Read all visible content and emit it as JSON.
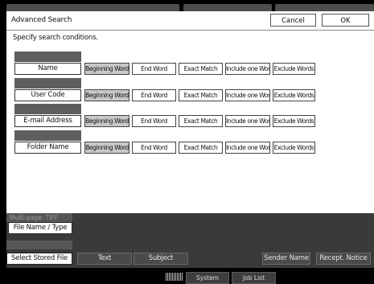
{
  "header": {
    "title": "Advanced Search",
    "cancel_label": "Cancel",
    "ok_label": "OK"
  },
  "instruction": "Specify search conditions.",
  "conditions": [
    {
      "label": "Name",
      "selected": "Beginning Word"
    },
    {
      "label": "User Code",
      "selected": "Beginning Word"
    },
    {
      "label": "E-mail Address",
      "selected": "Beginning Word"
    },
    {
      "label": "Folder Name",
      "selected": "Beginning Word"
    }
  ],
  "options": {
    "beginning": "Beginning Word",
    "end": "End Word",
    "exact": "Exact Match",
    "include": "Include one Word",
    "exclude": "Exclude Words"
  },
  "footer": {
    "multipage": "Multi-page: TIFF",
    "filename_type": "File Name / Type",
    "select_stored": "Select Stored File",
    "text": "Text",
    "subject": "Subject",
    "sender_name": "Sender Name",
    "recept_notice": "Recept. Notice"
  },
  "status_bar": {
    "system_status": "System Status",
    "job_list": "Job List"
  }
}
